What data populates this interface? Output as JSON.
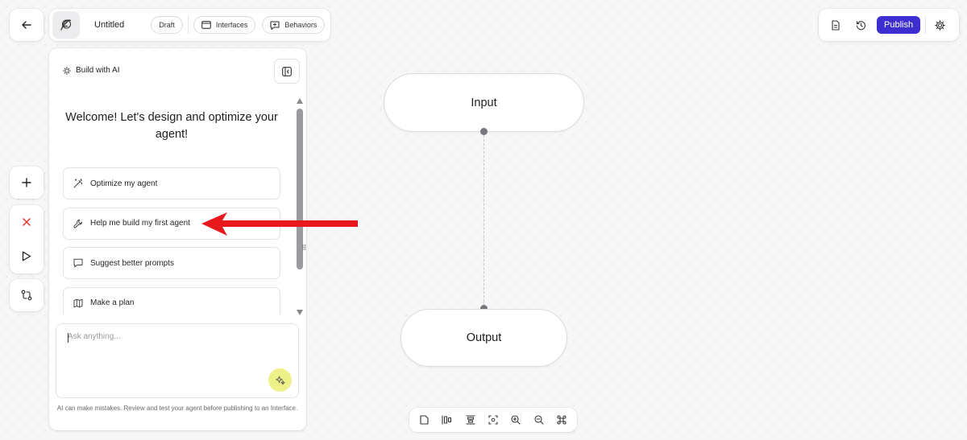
{
  "header": {
    "title": "Untitled",
    "status": "Draft",
    "tabs": [
      {
        "label": "Interfaces",
        "icon": "interface-icon"
      },
      {
        "label": "Behaviors",
        "icon": "behavior-icon"
      }
    ],
    "publish_label": "Publish"
  },
  "ai_panel": {
    "title": "Build with AI",
    "welcome": "Welcome! Let's design and optimize your agent!",
    "suggestions": [
      {
        "label": "Optimize my agent",
        "icon": "magic-wand-icon"
      },
      {
        "label": "Help me build my first agent",
        "icon": "wrench-icon"
      },
      {
        "label": "Suggest better prompts",
        "icon": "chat-bubble-icon"
      },
      {
        "label": "Make a plan",
        "icon": "map-icon"
      }
    ],
    "input_placeholder": "Ask anything...",
    "disclaimer": "AI can make mistakes. Review and test your agent before publishing to an Interface."
  },
  "canvas": {
    "nodes": [
      {
        "label": "Input"
      },
      {
        "label": "Output"
      }
    ]
  },
  "colors": {
    "publish": "#3d2ecf",
    "send_button": "#eef088",
    "annotation_arrow": "#e8191c",
    "close_tool": "#e0342b"
  }
}
